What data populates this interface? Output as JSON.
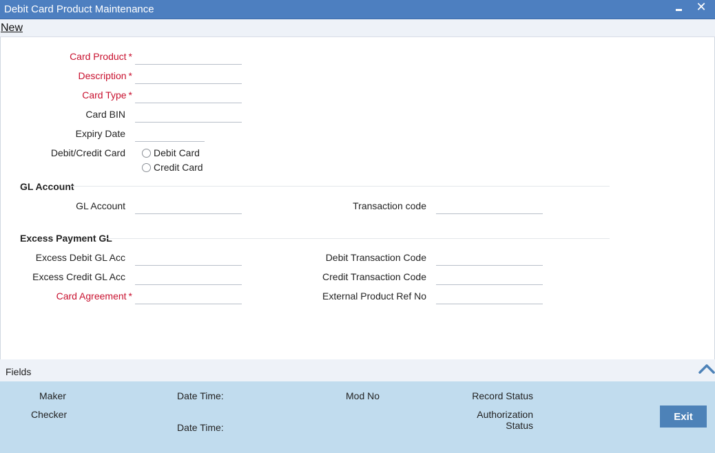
{
  "window": {
    "title": "Debit Card Product Maintenance",
    "minimize_glyph": "",
    "close_glyph": "✕"
  },
  "toolbar": {
    "new_label": "New"
  },
  "form": {
    "card_product": {
      "label": "Card Product",
      "required": "*",
      "value": ""
    },
    "description": {
      "label": "Description",
      "required": "*",
      "value": ""
    },
    "card_type": {
      "label": "Card Type",
      "required": "*",
      "value": ""
    },
    "card_bin": {
      "label": "Card BIN",
      "value": ""
    },
    "expiry_date": {
      "label": "Expiry Date",
      "value": ""
    },
    "debit_credit": {
      "label": "Debit/Credit Card",
      "options": [
        "Debit Card",
        "Credit Card"
      ],
      "selected": ""
    }
  },
  "gl_account_section": {
    "heading": "GL Account",
    "gl_account": {
      "label": "GL Account",
      "value": ""
    },
    "transaction_code": {
      "label": "Transaction code",
      "value": ""
    }
  },
  "excess_payment_section": {
    "heading": "Excess Payment GL",
    "excess_debit_gl": {
      "label": "Excess Debit GL Acc",
      "value": ""
    },
    "excess_credit_gl": {
      "label": "Excess Credit GL Acc",
      "value": ""
    },
    "card_agreement": {
      "label": "Card Agreement",
      "required": "*",
      "value": ""
    },
    "debit_transaction_code": {
      "label": "Debit Transaction Code",
      "value": ""
    },
    "credit_transaction_code": {
      "label": "Credit Transaction Code",
      "value": ""
    },
    "external_product_ref": {
      "label": "External Product Ref No",
      "value": ""
    }
  },
  "fields_bar": {
    "label": "Fields",
    "toggle_icon": "chevron-up-icon"
  },
  "footer": {
    "maker": "Maker",
    "checker": "Checker",
    "date_time_1": "Date Time:",
    "date_time_2": "Date Time:",
    "mod_no": "Mod No",
    "record_status": "Record Status",
    "authorization_status_line1": "Authorization",
    "authorization_status_line2": "Status",
    "exit_label": "Exit"
  },
  "colors": {
    "titlebar": "#4d7fc0",
    "required": "#c8102e",
    "footer": "#c1dcee",
    "exit_button": "#4d82b8"
  }
}
